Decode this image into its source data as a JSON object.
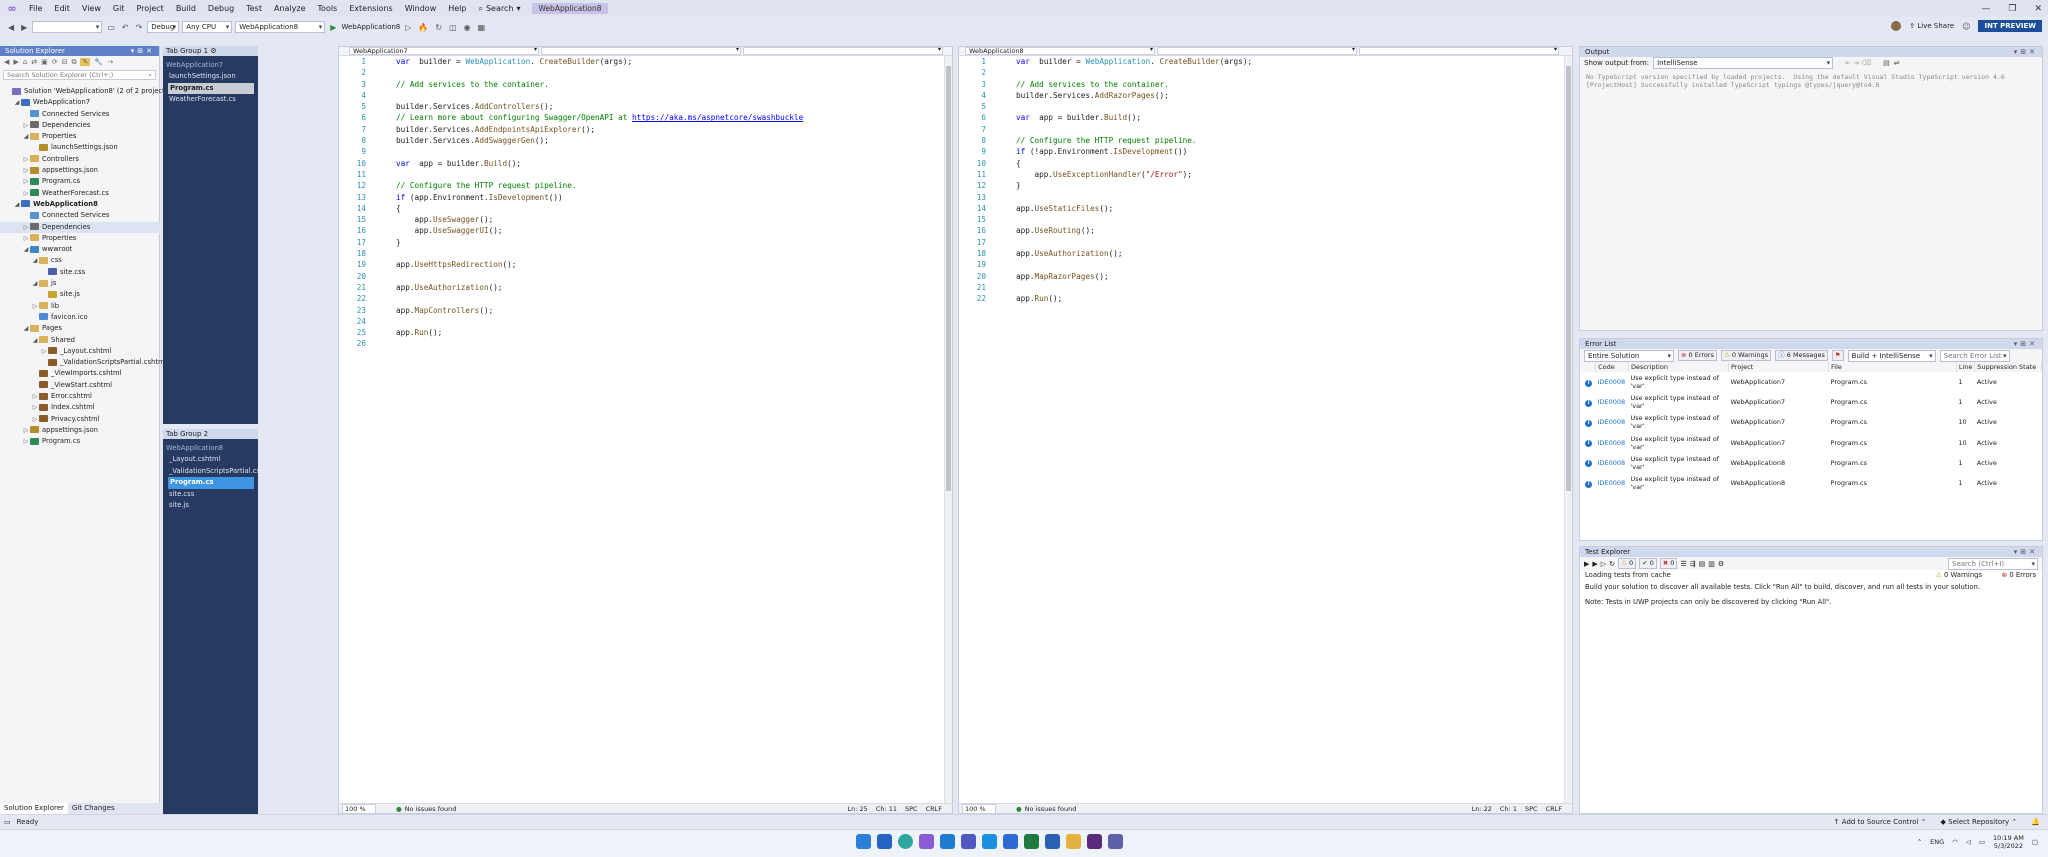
{
  "menu": {
    "logo_icon": "visual-studio-logo-icon",
    "items": [
      "File",
      "Edit",
      "View",
      "Git",
      "Project",
      "Build",
      "Debug",
      "Test",
      "Analyze",
      "Tools",
      "Extensions",
      "Window",
      "Help"
    ],
    "search": "Search",
    "solution_name": "WebApplication8",
    "window_controls": [
      "—",
      "❐",
      "✕"
    ]
  },
  "toolbar": {
    "config": "Debug",
    "platform": "Any CPU",
    "startup_project": "WebApplication8",
    "run_label": "WebApplication8",
    "live_share": "Live Share",
    "int_preview": "INT PREVIEW"
  },
  "solution_explorer": {
    "title": "Solution Explorer",
    "search_placeholder": "Search Solution Explorer (Ctrl+;)",
    "items": [
      {
        "indent": 0,
        "exp": "",
        "icon": "ic-sln",
        "label": "Solution 'WebApplication8' (2 of 2 projects)",
        "bold": false
      },
      {
        "indent": 1,
        "exp": "◢",
        "icon": "ic-proj",
        "label": "WebApplication7",
        "bold": false
      },
      {
        "indent": 2,
        "exp": "",
        "icon": "ic-conn",
        "label": "Connected Services",
        "bold": false
      },
      {
        "indent": 2,
        "exp": "▷",
        "icon": "ic-dep",
        "label": "Dependencies",
        "bold": false
      },
      {
        "indent": 2,
        "exp": "◢",
        "icon": "ic-fold",
        "label": "Properties",
        "bold": false
      },
      {
        "indent": 3,
        "exp": "",
        "icon": "ic-json",
        "label": "launchSettings.json",
        "bold": false
      },
      {
        "indent": 2,
        "exp": "▷",
        "icon": "ic-fold",
        "label": "Controllers",
        "bold": false
      },
      {
        "indent": 2,
        "exp": "▷",
        "icon": "ic-json",
        "label": "appsettings.json",
        "bold": false
      },
      {
        "indent": 2,
        "exp": "▷",
        "icon": "ic-cs",
        "label": "Program.cs",
        "bold": false
      },
      {
        "indent": 2,
        "exp": "▷",
        "icon": "ic-cs",
        "label": "WeatherForecast.cs",
        "bold": false
      },
      {
        "indent": 1,
        "exp": "◢",
        "icon": "ic-proj",
        "label": "WebApplication8",
        "bold": true
      },
      {
        "indent": 2,
        "exp": "",
        "icon": "ic-conn",
        "label": "Connected Services",
        "bold": false
      },
      {
        "indent": 2,
        "exp": "▷",
        "icon": "ic-dep",
        "label": "Dependencies",
        "bold": false,
        "sel": true
      },
      {
        "indent": 2,
        "exp": "▷",
        "icon": "ic-fold",
        "label": "Properties",
        "bold": false
      },
      {
        "indent": 2,
        "exp": "◢",
        "icon": "ic-web",
        "label": "wwwroot",
        "bold": false
      },
      {
        "indent": 3,
        "exp": "◢",
        "icon": "ic-fold",
        "label": "css",
        "bold": false
      },
      {
        "indent": 4,
        "exp": "",
        "icon": "ic-css",
        "label": "site.css",
        "bold": false
      },
      {
        "indent": 3,
        "exp": "◢",
        "icon": "ic-fold",
        "label": "js",
        "bold": false
      },
      {
        "indent": 4,
        "exp": "",
        "icon": "ic-js",
        "label": "site.js",
        "bold": false
      },
      {
        "indent": 3,
        "exp": "▷",
        "icon": "ic-fold",
        "label": "lib",
        "bold": false
      },
      {
        "indent": 3,
        "exp": "",
        "icon": "ic-ico",
        "label": "favicon.ico",
        "bold": false
      },
      {
        "indent": 2,
        "exp": "◢",
        "icon": "ic-fold",
        "label": "Pages",
        "bold": false
      },
      {
        "indent": 3,
        "exp": "◢",
        "icon": "ic-fold",
        "label": "Shared",
        "bold": false
      },
      {
        "indent": 4,
        "exp": "▷",
        "icon": "ic-html",
        "label": "_Layout.cshtml",
        "bold": false
      },
      {
        "indent": 4,
        "exp": "",
        "icon": "ic-html",
        "label": "_ValidationScriptsPartial.cshtml",
        "bold": false
      },
      {
        "indent": 3,
        "exp": "",
        "icon": "ic-html",
        "label": "_ViewImports.cshtml",
        "bold": false
      },
      {
        "indent": 3,
        "exp": "",
        "icon": "ic-html",
        "label": "_ViewStart.cshtml",
        "bold": false
      },
      {
        "indent": 3,
        "exp": "▷",
        "icon": "ic-html",
        "label": "Error.cshtml",
        "bold": false
      },
      {
        "indent": 3,
        "exp": "▷",
        "icon": "ic-html",
        "label": "Index.cshtml",
        "bold": false
      },
      {
        "indent": 3,
        "exp": "▷",
        "icon": "ic-html",
        "label": "Privacy.cshtml",
        "bold": false
      },
      {
        "indent": 2,
        "exp": "▷",
        "icon": "ic-json",
        "label": "appsettings.json",
        "bold": false
      },
      {
        "indent": 2,
        "exp": "▷",
        "icon": "ic-cs",
        "label": "Program.cs",
        "bold": false
      }
    ],
    "bottom_tabs": [
      "Solution Explorer",
      "Git Changes"
    ]
  },
  "tab_group_1": {
    "title": "Tab Group 1",
    "project": "WebApplication7",
    "items": [
      "launchSettings.json",
      "Program.cs",
      "WeatherForecast.cs"
    ]
  },
  "tab_group_2": {
    "title": "Tab Group 2",
    "project": "WebApplication8",
    "items": [
      "_Layout.cshtml",
      "_ValidationScriptsPartial.cshtml",
      "Program.cs",
      "site.css",
      "site.js"
    ]
  },
  "editor1": {
    "project": "WebApplication7",
    "zoom": "100 %",
    "issues": "No issues found",
    "pos": "Ln: 25",
    "col": "Ch: 11",
    "spc": "SPC",
    "crlf": "CRLF",
    "lines": [
      [
        [
          "kw",
          "var"
        ],
        [
          "",
          "  builder = "
        ],
        [
          "ty",
          "WebApplication"
        ],
        [
          "",
          ". "
        ],
        [
          "me",
          "CreateBuilder"
        ],
        [
          "",
          "(args);"
        ]
      ],
      [],
      [
        [
          "cm",
          "// Add services to the container."
        ]
      ],
      [],
      [
        [
          "",
          "builder.Services."
        ],
        [
          "me",
          "AddControllers"
        ],
        [
          "",
          "();"
        ]
      ],
      [
        [
          "cm",
          "// Learn more about configuring Swagger/OpenAPI at "
        ],
        [
          "lk",
          "https://aka.ms/aspnetcore/swashbuckle"
        ]
      ],
      [
        [
          "",
          "builder.Services."
        ],
        [
          "me",
          "AddEndpointsApiExplorer"
        ],
        [
          "",
          "();"
        ]
      ],
      [
        [
          "",
          "builder.Services."
        ],
        [
          "me",
          "AddSwaggerGen"
        ],
        [
          "",
          "();"
        ]
      ],
      [],
      [
        [
          "kw",
          "var"
        ],
        [
          "",
          "  app = builder."
        ],
        [
          "me",
          "Build"
        ],
        [
          "",
          "();"
        ]
      ],
      [],
      [
        [
          "cm",
          "// Configure the HTTP request pipeline."
        ]
      ],
      [
        [
          "kw",
          "if"
        ],
        [
          "",
          " (app.Environment."
        ],
        [
          "me",
          "IsDevelopment"
        ],
        [
          "",
          "())"
        ]
      ],
      [
        [
          "",
          "{"
        ]
      ],
      [
        [
          "",
          "    app."
        ],
        [
          "me",
          "UseSwagger"
        ],
        [
          "",
          "();"
        ]
      ],
      [
        [
          "",
          "    app."
        ],
        [
          "me",
          "UseSwaggerUI"
        ],
        [
          "",
          "();"
        ]
      ],
      [
        [
          "",
          "}"
        ]
      ],
      [],
      [
        [
          "",
          "app."
        ],
        [
          "me",
          "UseHttpsRedirection"
        ],
        [
          "",
          "();"
        ]
      ],
      [],
      [
        [
          "",
          "app."
        ],
        [
          "me",
          "UseAuthorization"
        ],
        [
          "",
          "();"
        ]
      ],
      [],
      [
        [
          "",
          "app."
        ],
        [
          "me",
          "MapControllers"
        ],
        [
          "",
          "();"
        ]
      ],
      [],
      [
        [
          "",
          "app."
        ],
        [
          "me",
          "Run"
        ],
        [
          "",
          "();"
        ]
      ],
      []
    ]
  },
  "editor2": {
    "project": "WebApplication8",
    "zoom": "100 %",
    "issues": "No issues found",
    "pos": "Ln: 22",
    "col": "Ch: 1",
    "spc": "SPC",
    "crlf": "CRLF",
    "lines": [
      [
        [
          "kw",
          "var"
        ],
        [
          "",
          "  builder = "
        ],
        [
          "ty",
          "WebApplication"
        ],
        [
          "",
          ". "
        ],
        [
          "me",
          "CreateBuilder"
        ],
        [
          "",
          "(args);"
        ]
      ],
      [],
      [
        [
          "cm",
          "// Add services to the container."
        ]
      ],
      [
        [
          "",
          "builder.Services."
        ],
        [
          "me",
          "AddRazorPages"
        ],
        [
          "",
          "();"
        ]
      ],
      [],
      [
        [
          "kw",
          "var"
        ],
        [
          "",
          "  app = builder."
        ],
        [
          "me",
          "Build"
        ],
        [
          "",
          "();"
        ]
      ],
      [],
      [
        [
          "cm",
          "// Configure the HTTP request pipeline."
        ]
      ],
      [
        [
          "kw",
          "if"
        ],
        [
          "",
          " (!app.Environment."
        ],
        [
          "me",
          "IsDevelopment"
        ],
        [
          "",
          "())"
        ]
      ],
      [
        [
          "",
          "{"
        ]
      ],
      [
        [
          "",
          "    app."
        ],
        [
          "me",
          "UseExceptionHandler"
        ],
        [
          "",
          "("
        ],
        [
          "st",
          "\"/Error\""
        ],
        [
          "",
          ");"
        ]
      ],
      [
        [
          "",
          "}"
        ]
      ],
      [],
      [
        [
          "",
          "app."
        ],
        [
          "me",
          "UseStaticFiles"
        ],
        [
          "",
          "();"
        ]
      ],
      [],
      [
        [
          "",
          "app."
        ],
        [
          "me",
          "UseRouting"
        ],
        [
          "",
          "();"
        ]
      ],
      [],
      [
        [
          "",
          "app."
        ],
        [
          "me",
          "UseAuthorization"
        ],
        [
          "",
          "();"
        ]
      ],
      [],
      [
        [
          "",
          "app."
        ],
        [
          "me",
          "MapRazorPages"
        ],
        [
          "",
          "();"
        ]
      ],
      [],
      [
        [
          "",
          "app."
        ],
        [
          "me",
          "Run"
        ],
        [
          "",
          "();"
        ]
      ]
    ]
  },
  "output": {
    "title": "Output",
    "show_from_label": "Show output from:",
    "source": "IntelliSense",
    "lines": [
      "No TypeScript version specified by loaded projects.  Using the default Visual Studio TypeScript version 4.6",
      "[ProjectHost] Successfully installed TypeScript typings @types/jquery@to4.6"
    ]
  },
  "error_list": {
    "title": "Error List",
    "scope": "Entire Solution",
    "errors": "0 Errors",
    "warnings": "0 Warnings",
    "messages": "6 Messages",
    "build_filter": "Build + IntelliSense",
    "search_placeholder": "Search Error List",
    "columns": [
      "",
      "Code",
      "Description",
      "Project",
      "File",
      "Line",
      "Suppression State"
    ],
    "rows": [
      {
        "code": "IDE0008",
        "desc": "Use explicit type instead of 'var'",
        "project": "WebApplication7",
        "file": "Program.cs",
        "line": "1",
        "state": "Active"
      },
      {
        "code": "IDE0008",
        "desc": "Use explicit type instead of 'var'",
        "project": "WebApplication7",
        "file": "Program.cs",
        "line": "1",
        "state": "Active"
      },
      {
        "code": "IDE0008",
        "desc": "Use explicit type instead of 'var'",
        "project": "WebApplication7",
        "file": "Program.cs",
        "line": "10",
        "state": "Active"
      },
      {
        "code": "IDE0008",
        "desc": "Use explicit type instead of 'var'",
        "project": "WebApplication7",
        "file": "Program.cs",
        "line": "10",
        "state": "Active"
      },
      {
        "code": "IDE0008",
        "desc": "Use explicit type instead of 'var'",
        "project": "WebApplication8",
        "file": "Program.cs",
        "line": "1",
        "state": "Active"
      },
      {
        "code": "IDE0008",
        "desc": "Use explicit type instead of 'var'",
        "project": "WebApplication8",
        "file": "Program.cs",
        "line": "1",
        "state": "Active"
      }
    ]
  },
  "test_explorer": {
    "title": "Test Explorer",
    "search_placeholder": "Search (Ctrl+I)",
    "loading": "Loading tests from cache",
    "warnings": "0 Warnings",
    "errors": "0 Errors",
    "counts": [
      "0",
      "0",
      "0"
    ],
    "msg1": "Build your solution to discover all available tests. Click \"Run All\" to build, discover, and run all tests in your solution.",
    "msg2": "Note: Tests in UWP projects can only be discovered by clicking \"Run All\"."
  },
  "statusbar": {
    "ready": "Ready",
    "add_source": "Add to Source Control",
    "select_repo": "Select Repository"
  },
  "taskbar": {
    "lang": "ENG",
    "time": "10:19 AM",
    "date": "5/3/2022"
  }
}
